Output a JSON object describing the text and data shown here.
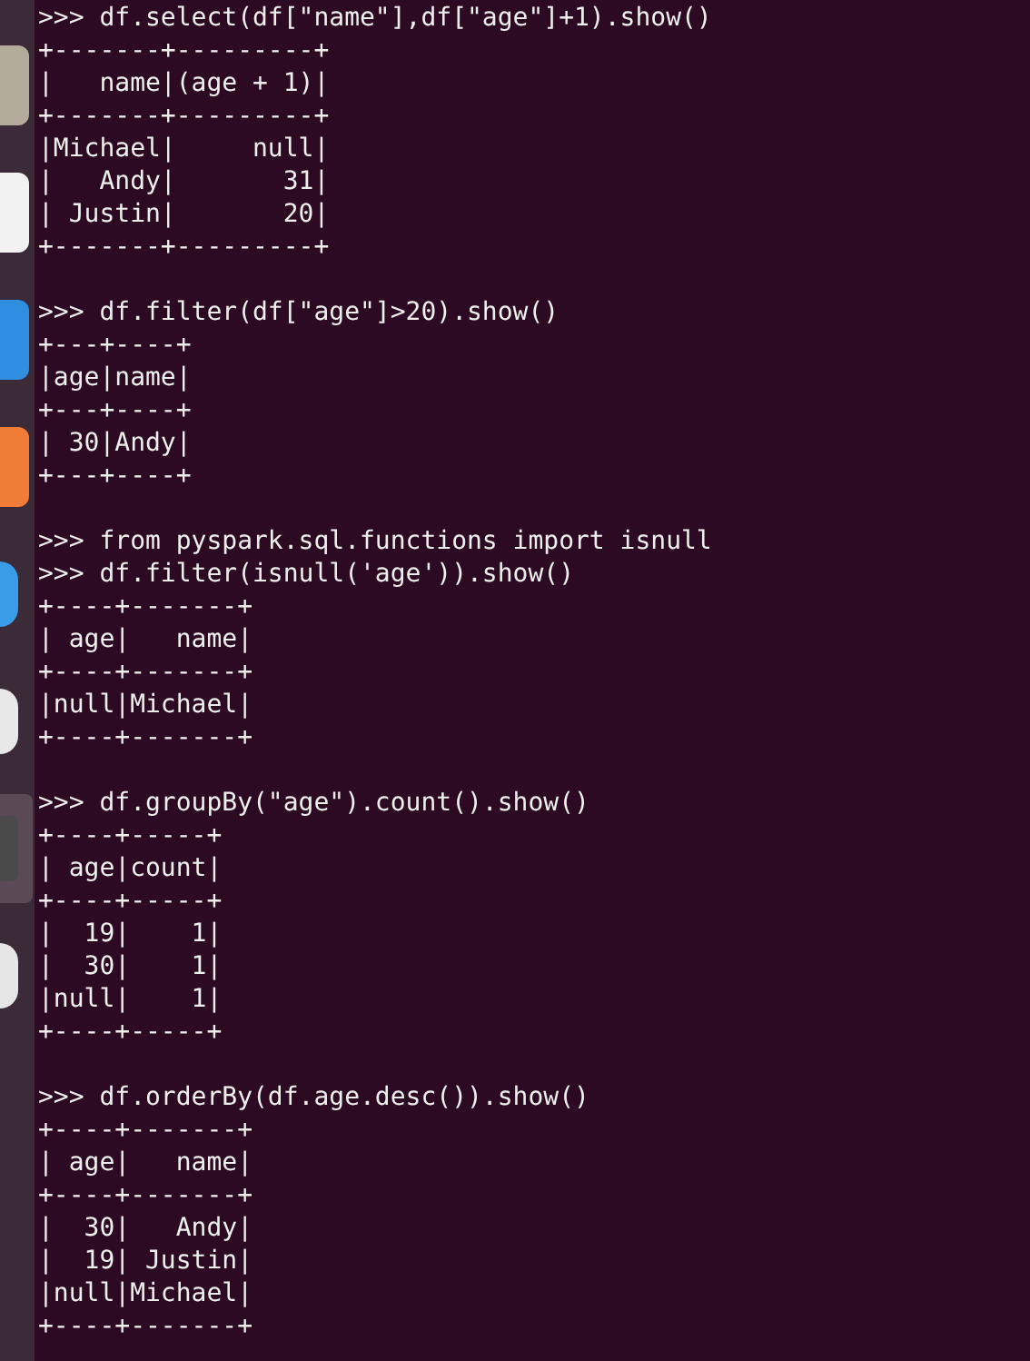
{
  "dock": {
    "icons": [
      {
        "kind": "rounded",
        "color": "#b3ab9c"
      },
      {
        "kind": "rounded",
        "color": "#f2f2f2"
      },
      {
        "kind": "rounded",
        "color": "#2f8ee0"
      },
      {
        "kind": "rounded",
        "color": "#f07c37"
      },
      {
        "kind": "circle",
        "color": "#3a9be6"
      },
      {
        "kind": "circle",
        "color": "#e8e8e8"
      },
      {
        "kind": "active",
        "color": "#4a4a4a"
      },
      {
        "kind": "circle",
        "color": "#e6e6e6"
      }
    ]
  },
  "terminal": {
    "blocks": [
      {
        "lines": [
          ">>> df.select(df[\"name\"],df[\"age\"]+1).show()",
          "+-------+---------+",
          "|   name|(age + 1)|",
          "+-------+---------+",
          "|Michael|     null|",
          "|   Andy|       31|",
          "| Justin|       20|",
          "+-------+---------+"
        ]
      },
      {
        "lines": [
          ">>> df.filter(df[\"age\"]>20).show()",
          "+---+----+",
          "|age|name|",
          "+---+----+",
          "| 30|Andy|",
          "+---+----+"
        ]
      },
      {
        "lines": [
          ">>> from pyspark.sql.functions import isnull",
          ">>> df.filter(isnull('age')).show()",
          "+----+-------+",
          "| age|   name|",
          "+----+-------+",
          "|null|Michael|",
          "+----+-------+"
        ]
      },
      {
        "lines": [
          ">>> df.groupBy(\"age\").count().show()",
          "+----+-----+",
          "| age|count|",
          "+----+-----+",
          "|  19|    1|",
          "|  30|    1|",
          "|null|    1|",
          "+----+-----+"
        ]
      },
      {
        "lines": [
          ">>> df.orderBy(df.age.desc()).show()",
          "+----+-------+",
          "| age|   name|",
          "+----+-------+",
          "|  30|   Andy|",
          "|  19| Justin|",
          "|null|Michael|",
          "+----+-------+"
        ]
      }
    ]
  }
}
